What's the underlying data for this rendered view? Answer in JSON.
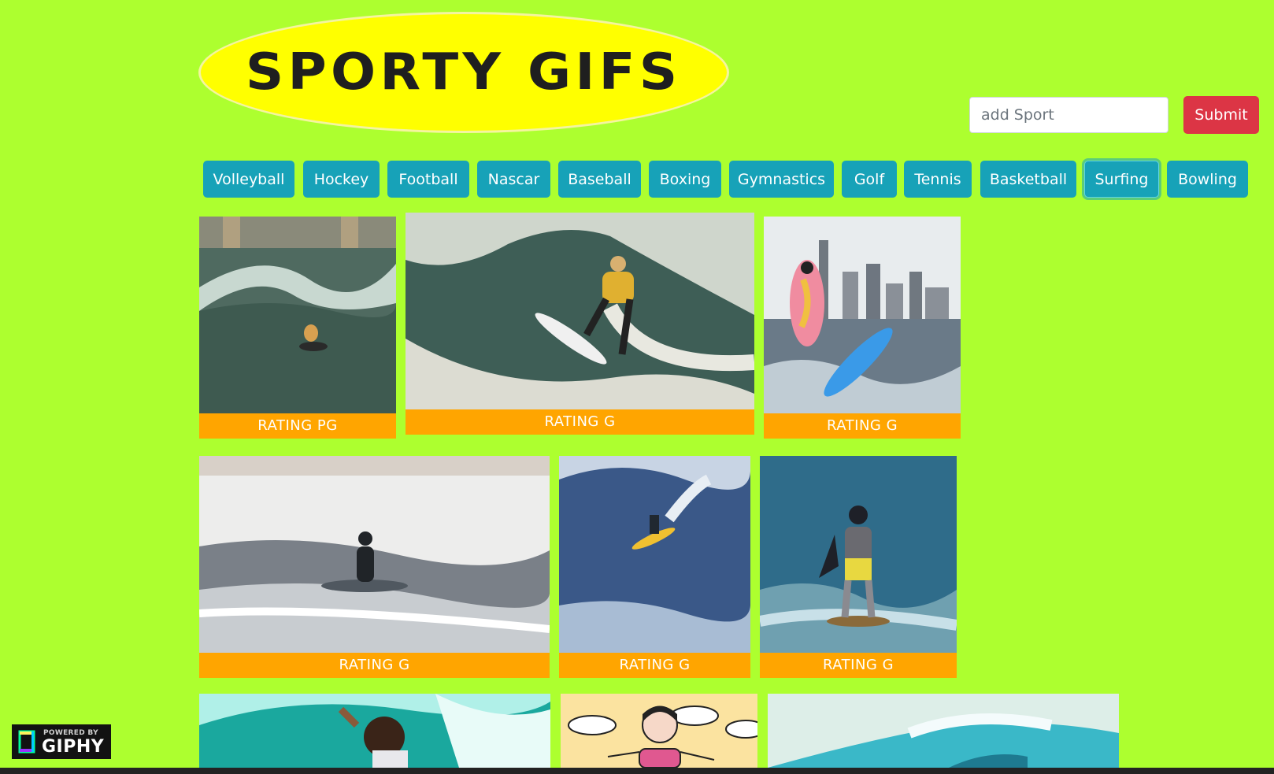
{
  "logo": {
    "text": "SPORTY GIFS"
  },
  "search": {
    "placeholder": "add Sport",
    "submit_label": "Submit"
  },
  "sports": [
    "Volleyball",
    "Hockey",
    "Football",
    "Nascar",
    "Baseball",
    "Boxing",
    "Gymnastics",
    "Golf",
    "Tennis",
    "Basketball",
    "Surfing",
    "Bowling"
  ],
  "active_sport": "Surfing",
  "gifs": [
    {
      "rating": "RATING PG",
      "description": "dog surfing a wave"
    },
    {
      "rating": "RATING G",
      "description": "surfer in yellow jersey riding wave"
    },
    {
      "rating": "RATING G",
      "description": "cartoon hot dog surfing near city skyline"
    },
    {
      "rating": "RATING G",
      "description": "surfer silhouette on sparkling water"
    },
    {
      "rating": "RATING G",
      "description": "surfer on big blue wave"
    },
    {
      "rating": "RATING G",
      "description": "batman surfing"
    },
    {
      "rating": "",
      "description": "woman waving in tube wave"
    },
    {
      "rating": "",
      "description": "cartoon girl in pink swimsuit"
    },
    {
      "rating": "",
      "description": "turquoise barrel wave"
    }
  ],
  "badge": {
    "top": "POWERED BY",
    "main": "GIPHY"
  },
  "colors": {
    "background": "#adff2f",
    "logo": "#ffff00",
    "button": "#17a2b8",
    "submit": "#dc3545",
    "rating": "#ffa500"
  }
}
